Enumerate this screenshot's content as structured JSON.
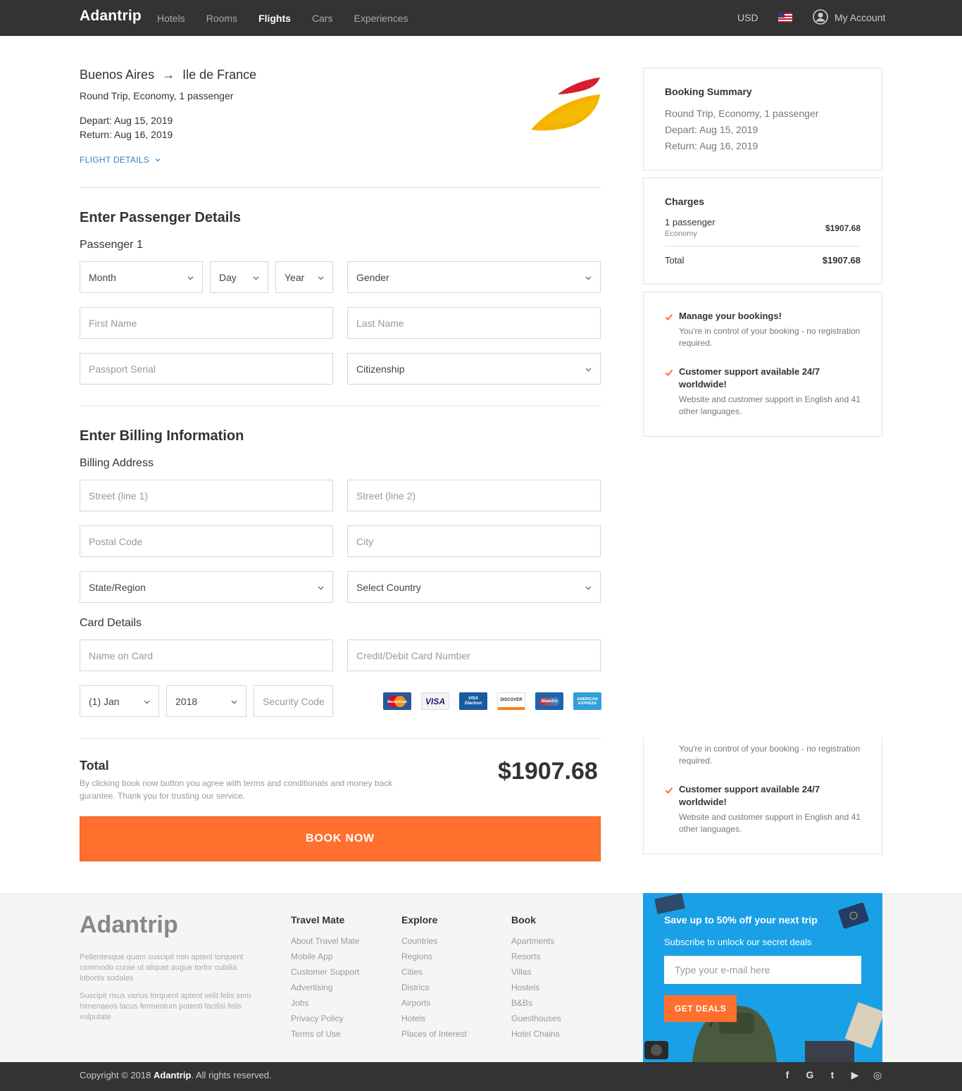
{
  "nav": {
    "logo": "Adantrip",
    "links": [
      "Hotels",
      "Rooms",
      "Flights",
      "Cars",
      "Experiences"
    ],
    "active": "Flights",
    "currency": "USD",
    "account": "My Account"
  },
  "flight": {
    "from": "Buenos Aires",
    "arrow": "→",
    "to": "Ile de France",
    "trip_info": "Round Trip, Economy, 1 passenger",
    "depart": "Depart: Aug 15, 2019",
    "return": "Return: Aug 16, 2019",
    "details_link": "FLIGHT DETAILS"
  },
  "passenger": {
    "section_title": "Enter Passenger Details",
    "subtitle": "Passenger 1",
    "month": "Month",
    "day": "Day",
    "year": "Year",
    "gender": "Gender",
    "first_name": "First Name",
    "last_name": "Last Name",
    "passport": "Passport Serial",
    "citizenship": "Citizenship"
  },
  "billing": {
    "section_title": "Enter Billing Information",
    "address_title": "Billing Address",
    "street1": "Street (line 1)",
    "street2": "Street (line 2)",
    "postal": "Postal Code",
    "city": "City",
    "state": "State/Region",
    "country": "Select Country",
    "card_title": "Card Details",
    "name_on_card": "Name on Card",
    "card_number": "Credit/Debit Card Number",
    "exp_month": "(1) Jan",
    "exp_year": "2018",
    "security": "Security Code",
    "cards": [
      "MasterCard",
      "VISA",
      "VISA Electron",
      "DISCOVER",
      "Maestro",
      "AMERICAN EXPRESS"
    ]
  },
  "total": {
    "label": "Total",
    "note": "By clicking book now button you agree with terms and conditionals and money back gurantee. Thank you for trusting our service.",
    "amount": "$1907.68",
    "book_button": "BOOK NOW"
  },
  "summary": {
    "title": "Booking Summary",
    "trip_info": "Round Trip, Economy, 1 passenger",
    "depart": "Depart: Aug 15, 2019",
    "return": "Return: Aug 16, 2019"
  },
  "charges": {
    "title": "Charges",
    "item": "1 passenger",
    "item_class": "Economy",
    "item_value": "$1907.68",
    "total_label": "Total",
    "total_value": "$1907.68"
  },
  "benefits": [
    {
      "title": "Manage your bookings!",
      "text": "You're in control of your booking - no registration required."
    },
    {
      "title": "Customer support available 24/7 worldwide!",
      "text": "Website and customer support in English and 41 other languages."
    }
  ],
  "footer": {
    "logo": "Adantrip",
    "p1": "Pellentesque quam suscipit non aptent torquent commodo curae ut aliquet augue tortor cubilia lobortis sodales",
    "p2": "Suscipit risus varius torquent aptent velit felis sem himenaeos lacus fermentum potenti facilisi felis vulputate",
    "columns": [
      {
        "title": "Travel Mate",
        "items": [
          "About Travel Mate",
          "Mobile App",
          "Customer Support",
          "Advertising",
          "Jobs",
          "Privacy Policy",
          "Terms of Use"
        ]
      },
      {
        "title": "Explore",
        "items": [
          "Countries",
          "Regions",
          "Cities",
          "Districs",
          "Airports",
          "Hotels",
          "Places of Interest"
        ]
      },
      {
        "title": "Book",
        "items": [
          "Apartments",
          "Resorts",
          "Villas",
          "Hostels",
          "B&Bs",
          "Guesthouses",
          "Hotel Chains"
        ]
      }
    ],
    "promo": {
      "title": "Save up to 50% off your next trip",
      "subtitle": "Subscribe to unlock our secret deals",
      "placeholder": "Type your e-mail here",
      "button": "GET DEALS"
    },
    "copyright_prefix": "Copyright © 2018 ",
    "copyright_brand": "Adantrip",
    "copyright_suffix": ". All rights reserved.",
    "socials": [
      "f",
      "G",
      "t",
      "▶",
      "◎"
    ]
  },
  "colors": {
    "accent": "#ff6f2e",
    "nav_bg": "#333333",
    "link_blue": "#3a7bbf",
    "promo_blue": "#1aa0e6"
  }
}
